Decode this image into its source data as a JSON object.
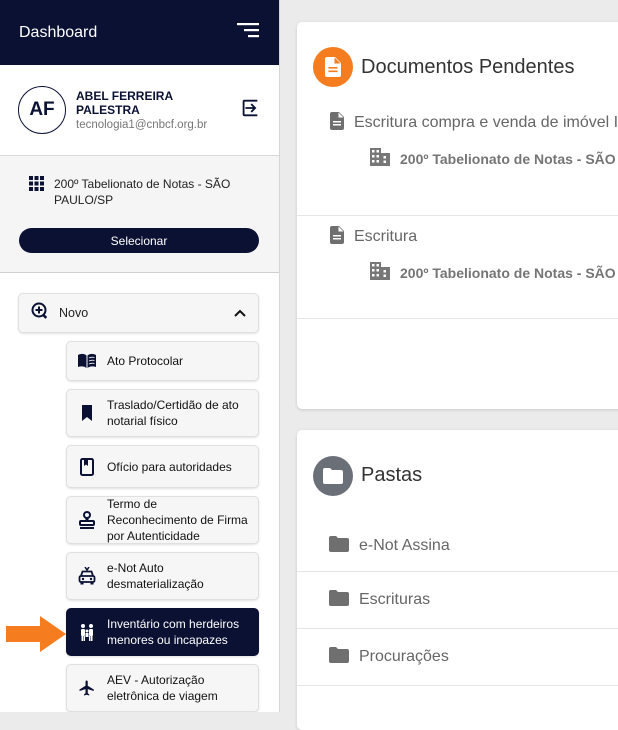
{
  "sidebar": {
    "title": "Dashboard",
    "user": {
      "initials": "AF",
      "name": "ABEL FERREIRA PALESTRA",
      "email": "tecnologia1@cnbcf.org.br"
    },
    "office": {
      "name": "200º Tabelionato de Notas - SÃO PAULO/SP",
      "select_label": "Selecionar"
    },
    "novo_label": "Novo",
    "items": [
      {
        "label": "Ato Protocolar",
        "icon": "book-open-icon"
      },
      {
        "label": "Traslado/Certidão de ato notarial físico",
        "icon": "bookmark-icon"
      },
      {
        "label": "Ofício para autoridades",
        "icon": "book-icon"
      },
      {
        "label": "Termo de Reconhecimento de Firma por Autenticidade",
        "icon": "stamp-icon"
      },
      {
        "label": "e-Not Auto desmaterialização",
        "icon": "car-icon"
      },
      {
        "label": "Inventário com herdeiros menores ou incapazes",
        "icon": "family-icon"
      },
      {
        "label": "AEV - Autorização eletrônica de viagem",
        "icon": "airplane-icon"
      }
    ]
  },
  "documents": {
    "title": "Documentos Pendentes",
    "items": [
      {
        "title": "Escritura compra e venda de imóvel I",
        "office": "200º Tabelionato de Notas - SÃO"
      },
      {
        "title": "Escritura",
        "office": "200º Tabelionato de Notas - SÃO"
      }
    ]
  },
  "folders": {
    "title": "Pastas",
    "items": [
      {
        "label": "e-Not Assina"
      },
      {
        "label": "Escrituras"
      },
      {
        "label": "Procurações"
      }
    ]
  },
  "colors": {
    "navy": "#0b1133",
    "orange": "#f57c1f",
    "folder_gray": "#6b6f78",
    "arrow": "#f57c1f"
  }
}
